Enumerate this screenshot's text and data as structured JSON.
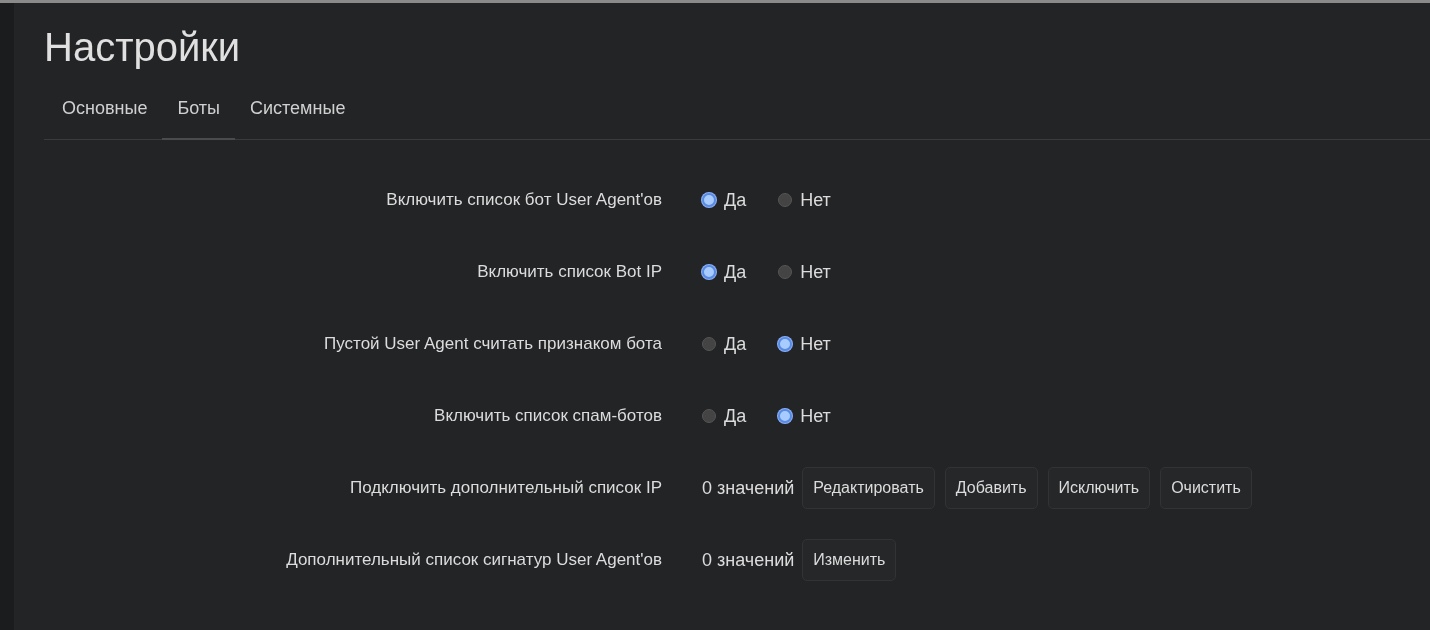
{
  "title": "Настройки",
  "tabs": [
    {
      "label": "Основные",
      "selected": false
    },
    {
      "label": "Боты",
      "selected": true
    },
    {
      "label": "Системные",
      "selected": false
    }
  ],
  "settings": [
    {
      "kind": "radio",
      "label": "Включить список бот User Agent'ов",
      "options": [
        {
          "label": "Да",
          "selected": true
        },
        {
          "label": "Нет",
          "selected": false
        }
      ]
    },
    {
      "kind": "radio",
      "label": "Включить список Bot IP",
      "options": [
        {
          "label": "Да",
          "selected": true
        },
        {
          "label": "Нет",
          "selected": false
        }
      ]
    },
    {
      "kind": "radio",
      "label": "Пустой User Agent считать признаком бота",
      "options": [
        {
          "label": "Да",
          "selected": false
        },
        {
          "label": "Нет",
          "selected": true
        }
      ]
    },
    {
      "kind": "radio",
      "label": "Включить список спам-ботов",
      "options": [
        {
          "label": "Да",
          "selected": false
        },
        {
          "label": "Нет",
          "selected": true
        }
      ]
    },
    {
      "kind": "list",
      "label": "Подключить дополнительный список IP",
      "count": "0 значений",
      "buttons": [
        "Редактировать",
        "Добавить",
        "Исключить",
        "Очистить"
      ]
    },
    {
      "kind": "list",
      "label": "Дополнительный список сигнатур User Agent'ов",
      "count": "0 значений",
      "buttons": [
        "Изменить"
      ]
    }
  ]
}
